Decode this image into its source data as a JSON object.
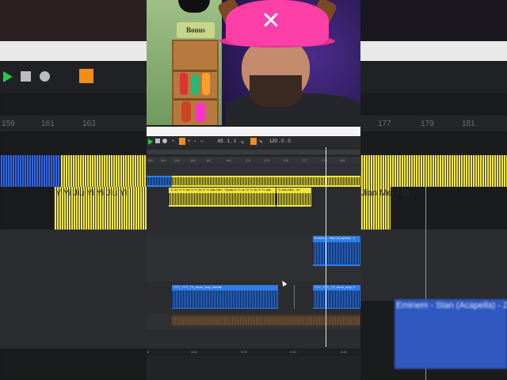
{
  "background": {
    "ruler_labels": [
      "159",
      "161",
      "163",
      "177",
      "179",
      "181"
    ],
    "left_clip_text": "Y Yi Jiu Yi Yi Jiu Yi",
    "right_clip_text": "Jian Mei - Vi",
    "right_blue_clip_text": "Eminem - Stan (Acapella) - Z"
  },
  "webcam": {
    "sign_text": "Bonus"
  },
  "toolbar": {
    "bar_readout": "65 . 1 . 1",
    "tempo": "120 . 0 . 0"
  },
  "arrangement": {
    "ruler": [
      "159",
      "161",
      "163",
      "165",
      "167",
      "169",
      "171",
      "173",
      "175",
      "177",
      "179",
      "181"
    ],
    "clips": [
      {
        "title": "Yi Jiu Yi Yi Jiu Yi Yi Jiu Yi Yi Jian Mei - Vocals D Yi Jiu Yi Yi Jiu Yi Yi Jian",
        "color": "#f0e43e"
      },
      {
        "title": "Yi Jian Mei - Vo",
        "color": "#f0e43e"
      },
      {
        "title": "Eminem - Stan (Acapella) - Z",
        "color": "#2f7de6"
      },
      {
        "title": "YYY_YYY_TS_drum_loop_ebeats",
        "color": "#2f7de6"
      },
      {
        "title": "YYY_YYY_TS_drum_loop_e",
        "color": "#2f7de6"
      }
    ],
    "time_ruler": [
      "0",
      "4:40",
      "5:00",
      "5:20",
      "5:40"
    ]
  },
  "colors": {
    "accent_orange": "#f28c1b",
    "play_green": "#27c93f",
    "clip_yellow": "#f0e43e",
    "clip_blue": "#2f7de6"
  }
}
